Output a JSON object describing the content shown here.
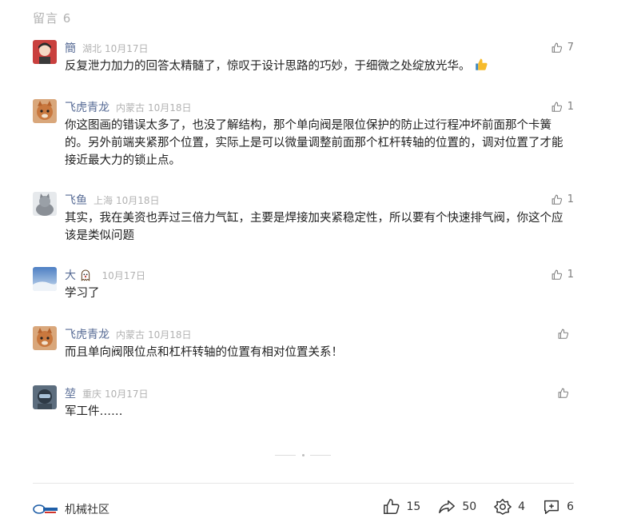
{
  "header": {
    "title": "留言 6"
  },
  "comments": [
    {
      "name": "簡",
      "location": "湖北",
      "date": "10月17日",
      "likes": "7",
      "text": "反复泄力加力的回答太精髓了，惊叹于设计思路的巧妙，于细微之处绽放光华。",
      "avatar": "avatar-girl"
    },
    {
      "name": "飞虎青龙",
      "location": "内蒙古",
      "date": "10月18日",
      "likes": "1",
      "text": "你这图画的错误太多了，也没了解结构，那个单向阀是限位保护的防止过行程冲坏前面那个卡簧的。另外前端夹紧那个位置，实际上是可以微量调整前面那个杠杆转轴的位置的，调对位置了才能接近最大力的锁止点。",
      "avatar": "avatar-cat"
    },
    {
      "name": "飞鱼",
      "location": "上海",
      "date": "10月18日",
      "likes": "1",
      "text": "其实，我在美资也弄过三倍力气缸，主要是焊接加夹紧稳定性，所以要有个快速排气阀，你这个应该是类似问题",
      "avatar": "avatar-gray-cat"
    },
    {
      "name": "大",
      "location": "",
      "date": "10月17日",
      "likes": "1",
      "text": "学习了",
      "avatar": "avatar-sky"
    },
    {
      "name": "飞虎青龙",
      "location": "内蒙古",
      "date": "10月18日",
      "likes": "",
      "text": "而且单向阀限位点和杠杆转轴的位置有相对位置关系！",
      "avatar": "avatar-cat"
    },
    {
      "name": "堃",
      "location": "重庆",
      "date": "10月17日",
      "likes": "",
      "text": "军工件……",
      "avatar": "avatar-pilot"
    }
  ],
  "footer": {
    "brand": "机械社区",
    "likes": "15",
    "shares": "50",
    "recommends": "4",
    "comments": "6"
  },
  "colors": {
    "name": "#576b95",
    "meta": "#b2b2b2",
    "text": "#222222"
  }
}
